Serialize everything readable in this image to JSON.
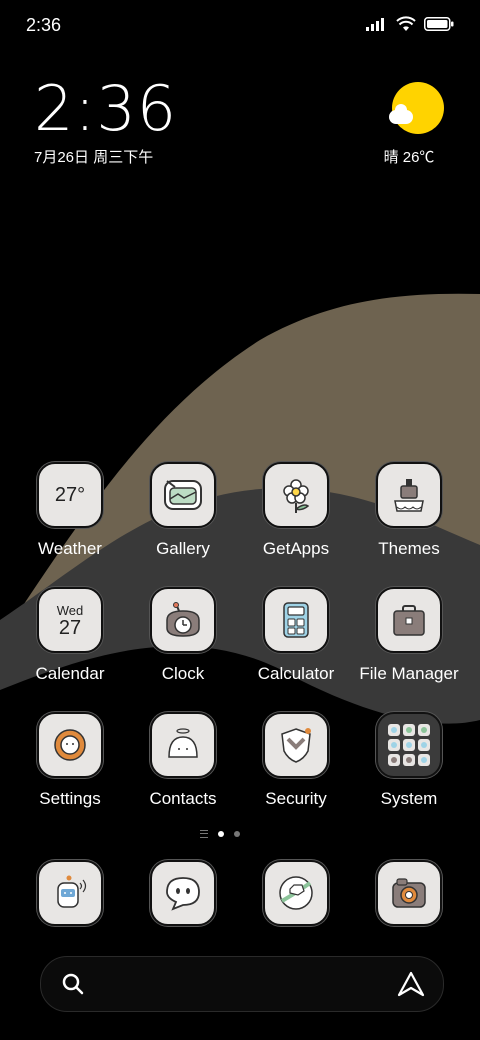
{
  "status_bar": {
    "time": "2:36"
  },
  "clock_widget": {
    "time": "2:36",
    "date": "7月26日 周三下午"
  },
  "weather_widget": {
    "text": "晴 26℃"
  },
  "apps": [
    {
      "name": "Weather",
      "icon": "weather-icon",
      "tile_text": "27°"
    },
    {
      "name": "Gallery",
      "icon": "gallery-icon"
    },
    {
      "name": "GetApps",
      "icon": "getapps-icon"
    },
    {
      "name": "Themes",
      "icon": "themes-icon"
    },
    {
      "name": "Calendar",
      "icon": "calendar-icon",
      "tile_day": "Wed",
      "tile_date": "27"
    },
    {
      "name": "Clock",
      "icon": "clock-icon"
    },
    {
      "name": "Calculator",
      "icon": "calculator-icon"
    },
    {
      "name": "File Manager",
      "icon": "file-manager-icon"
    },
    {
      "name": "Settings",
      "icon": "settings-icon"
    },
    {
      "name": "Contacts",
      "icon": "contacts-icon"
    },
    {
      "name": "Security",
      "icon": "security-icon"
    },
    {
      "name": "System",
      "icon": "system-folder-icon"
    }
  ],
  "dock": [
    {
      "icon": "phone-icon"
    },
    {
      "icon": "messages-icon"
    },
    {
      "icon": "browser-icon"
    },
    {
      "icon": "camera-icon"
    }
  ],
  "pager": {
    "active_index": 1,
    "count": 2
  },
  "colors": {
    "wave_tan": "#6e6350",
    "wave_dark": "#3a3a3a",
    "sun": "#ffd300",
    "tile": "#e8e6e4"
  }
}
